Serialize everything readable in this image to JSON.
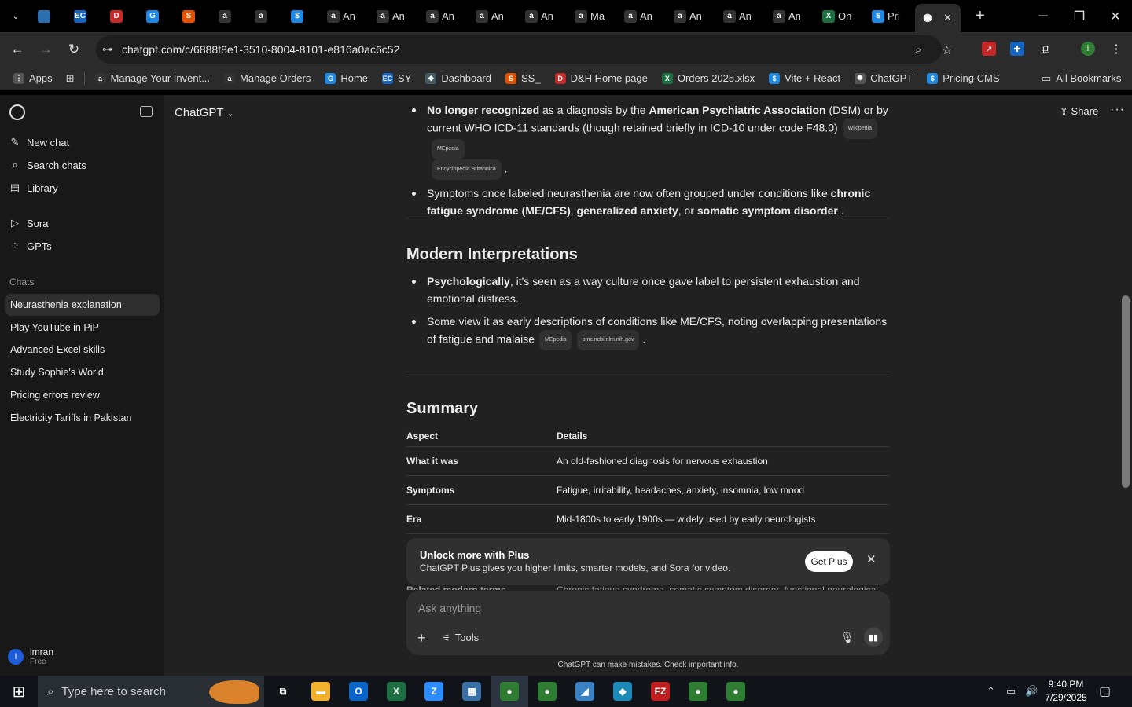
{
  "browser": {
    "tabs": [
      {
        "label": "",
        "icon": "tab-icon",
        "color": "#2a6fb0"
      },
      {
        "label": "",
        "icon": "ec-icon",
        "color": "#1565c0",
        "glyph": "EC"
      },
      {
        "label": "",
        "icon": "dh-icon",
        "color": "#c62828",
        "glyph": "D"
      },
      {
        "label": "",
        "icon": "g-icon",
        "color": "#1e88e5",
        "glyph": "G"
      },
      {
        "label": "",
        "icon": "layers-icon",
        "color": "#e65100",
        "glyph": "S"
      },
      {
        "label": "",
        "icon": "amazon-icon",
        "color": "#333",
        "glyph": "a"
      },
      {
        "label": "",
        "icon": "amazon-icon",
        "color": "#333",
        "glyph": "a"
      },
      {
        "label": "",
        "icon": "dollar-icon",
        "color": "#1e88e5",
        "glyph": "$"
      },
      {
        "label": "An",
        "icon": "amazon-icon",
        "color": "#333",
        "glyph": "a"
      },
      {
        "label": "An",
        "icon": "amazon-icon",
        "color": "#333",
        "glyph": "a"
      },
      {
        "label": "An",
        "icon": "amazon-icon",
        "color": "#333",
        "glyph": "a"
      },
      {
        "label": "An",
        "icon": "amazon-icon",
        "color": "#333",
        "glyph": "a"
      },
      {
        "label": "An",
        "icon": "amazon-icon",
        "color": "#333",
        "glyph": "a"
      },
      {
        "label": "Ma",
        "icon": "amazon-icon",
        "color": "#333",
        "glyph": "a"
      },
      {
        "label": "An",
        "icon": "amazon-icon",
        "color": "#333",
        "glyph": "a"
      },
      {
        "label": "An",
        "icon": "amazon-icon",
        "color": "#333",
        "glyph": "a"
      },
      {
        "label": "An",
        "icon": "amazon-icon",
        "color": "#333",
        "glyph": "a"
      },
      {
        "label": "An",
        "icon": "amazon-icon",
        "color": "#333",
        "glyph": "a"
      },
      {
        "label": "On",
        "icon": "excel-icon",
        "color": "#1d6f42",
        "glyph": "X"
      },
      {
        "label": "Pri",
        "icon": "dollar-icon",
        "color": "#1e88e5",
        "glyph": "$"
      }
    ],
    "url": "chatgpt.com/c/6888f8e1-3510-8004-8101-e816a0ac6c52",
    "bookmarks": [
      {
        "label": "Apps",
        "color": "#555",
        "glyph": "⋮"
      },
      {
        "label": "Manage Your Invent...",
        "color": "#333",
        "glyph": "a"
      },
      {
        "label": "Manage Orders",
        "color": "#333",
        "glyph": "a"
      },
      {
        "label": "Home",
        "color": "#1e88e5",
        "glyph": "G"
      },
      {
        "label": "SY",
        "color": "#1565c0",
        "glyph": "EC"
      },
      {
        "label": "Dashboard",
        "color": "#455a64",
        "glyph": "◆"
      },
      {
        "label": "SS_",
        "color": "#e65100",
        "glyph": "S"
      },
      {
        "label": "D&H Home page",
        "color": "#c62828",
        "glyph": "D"
      },
      {
        "label": "Orders 2025.xlsx",
        "color": "#1d6f42",
        "glyph": "X"
      },
      {
        "label": "Vite + React",
        "color": "#1e88e5",
        "glyph": "$"
      },
      {
        "label": "ChatGPT",
        "color": "#555",
        "glyph": "✺"
      },
      {
        "label": "Pricing CMS",
        "color": "#1e88e5",
        "glyph": "$"
      }
    ],
    "all_bookmarks": "All Bookmarks"
  },
  "sidebar": {
    "nav": [
      {
        "label": "New chat",
        "icon": "edit-icon",
        "glyph": "✎"
      },
      {
        "label": "Search chats",
        "icon": "search-icon",
        "glyph": "⌕"
      },
      {
        "label": "Library",
        "icon": "library-icon",
        "glyph": "▤"
      },
      {
        "label": "Sora",
        "icon": "play-icon",
        "glyph": "▷"
      },
      {
        "label": "GPTs",
        "icon": "grid-icon",
        "glyph": "⁘"
      }
    ],
    "chats_heading": "Chats",
    "chats": [
      "Neurasthenia explanation",
      "Play YouTube in PiP",
      "Advanced Excel skills",
      "Study Sophie's World",
      "Pricing errors review",
      "Electricity Tariffs in Pakistan"
    ],
    "user": {
      "initial": "I",
      "name": "imran",
      "plan": "Free"
    }
  },
  "header": {
    "model": "ChatGPT",
    "share": "Share"
  },
  "content": {
    "b1_bold1": "No longer recognized",
    "b1_t1": " as a diagnosis by the ",
    "b1_bold2": "American Psychiatric Association",
    "b1_t2": " (DSM) or by current WHO ICD-11 standards (though retained briefly in ICD-10 under code F48.0)",
    "b1_src1": "Wikipedia",
    "b1_src2": "MEpedia",
    "b1_src3": "Encyclopedia Britannica",
    "b2_t1": "Symptoms once labeled neurasthenia are now often grouped under conditions like ",
    "b2_bold1": "chronic fatigue syndrome (ME/CFS)",
    "b2_t2": ", ",
    "b2_bold2": "generalized anxiety",
    "b2_t3": ", or ",
    "b2_bold3": "somatic symptom disorder",
    "h_modern": "Modern Interpretations",
    "m1_bold": "Psychologically",
    "m1_t": ", it's seen as a way culture once gave label to persistent exhaustion and emotional distress.",
    "m2_t": "Some view it as early descriptions of conditions like ME/CFS, noting overlapping presentations of fatigue and malaise",
    "m2_src1": "MEpedia",
    "m2_src2": "pmc.ncbi.nlm.nih.gov",
    "h_summary": "Summary",
    "table": {
      "headers": [
        "Aspect",
        "Details"
      ],
      "rows": [
        [
          "What it was",
          "An old-fashioned diagnosis for nervous exhaustion"
        ],
        [
          "Symptoms",
          "Fatigue, irritability, headaches, anxiety, insomnia, low mood"
        ],
        [
          "Era",
          "Mid-1800s to early 1900s — widely used by early neurologists"
        ]
      ],
      "peek_aspect": "Related modern terms",
      "peek_details": "Chronic fatigue syndrome, somatic symptom disorder, functional neurological"
    }
  },
  "upsell": {
    "title": "Unlock more with Plus",
    "text": "ChatGPT Plus gives you higher limits, smarter models, and Sora for video.",
    "button": "Get Plus"
  },
  "composer": {
    "placeholder": "Ask anything",
    "tools": "Tools"
  },
  "disclaimer": "ChatGPT can make mistakes. Check important info.",
  "taskbar": {
    "search_placeholder": "Type here to search",
    "time": "9:40 PM",
    "date": "7/29/2025",
    "apps": [
      {
        "icon": "task-view-icon",
        "color": "transparent",
        "glyph": "⧉"
      },
      {
        "icon": "file-explorer-icon",
        "color": "#f2b22e",
        "glyph": "▬"
      },
      {
        "icon": "outlook-icon",
        "color": "#0a64c8",
        "glyph": "O"
      },
      {
        "icon": "excel-icon",
        "color": "#1d6f42",
        "glyph": "X"
      },
      {
        "icon": "zoom-icon",
        "color": "#2d8cff",
        "glyph": "Z"
      },
      {
        "icon": "calculator-icon",
        "color": "#3a6ea5",
        "glyph": "▦"
      },
      {
        "icon": "chrome-icon",
        "color": "#2e7d32",
        "glyph": "●"
      },
      {
        "icon": "chrome-icon",
        "color": "#2e7d32",
        "glyph": "●"
      },
      {
        "icon": "notes-icon",
        "color": "#3b82c4",
        "glyph": "◢"
      },
      {
        "icon": "app-icon",
        "color": "#1b8ab8",
        "glyph": "◆"
      },
      {
        "icon": "filezilla-icon",
        "color": "#bf1e1e",
        "glyph": "FZ"
      },
      {
        "icon": "chrome-icon",
        "color": "#2e7d32",
        "glyph": "●"
      },
      {
        "icon": "chrome-icon",
        "color": "#2e7d32",
        "glyph": "●"
      }
    ]
  }
}
